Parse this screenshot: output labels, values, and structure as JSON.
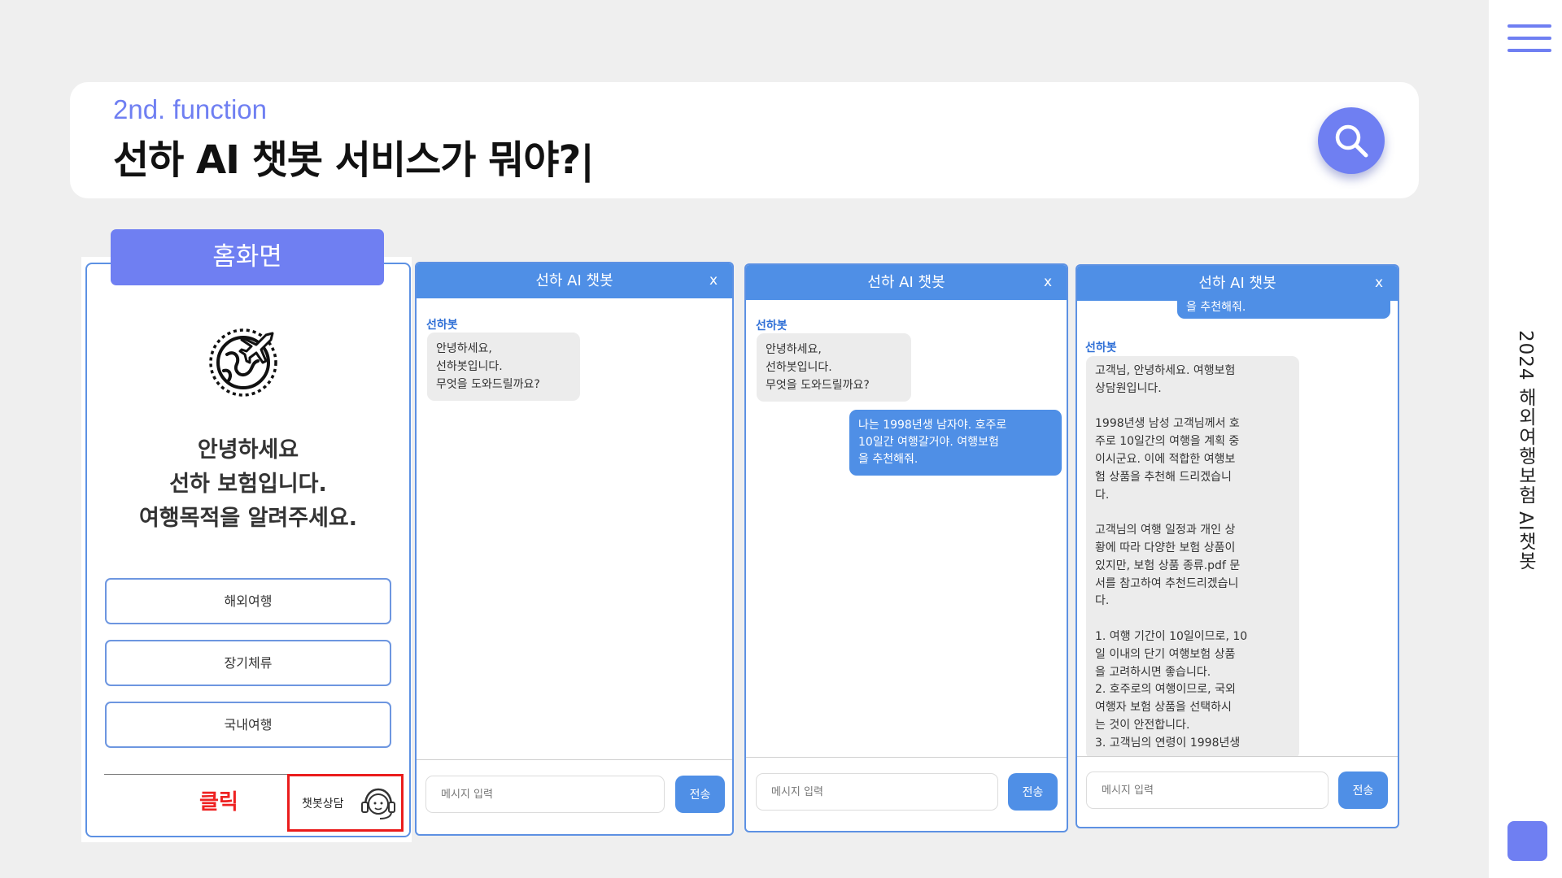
{
  "header": {
    "subtitle": "2nd. function",
    "title": "선하 AI 챗봇 서비스가 뭐야?|"
  },
  "sidebar": {
    "vertical_title": "2024 해외여행보험 AI챗봇",
    "menu_icon": "hamburger-icon"
  },
  "home": {
    "tab_label": "홈화면",
    "greeting_lines": [
      "안녕하세요",
      "선하 보험입니다.",
      "여행목적을 알려주세요."
    ],
    "options": [
      "해외여행",
      "장기체류",
      "국내여행"
    ],
    "click_label": "클릭",
    "chat_button_label": "챗봇상담",
    "icons": [
      "globe-plane-icon",
      "headset-agent-icon"
    ]
  },
  "chat": {
    "title": "선하 AI 챗봇",
    "close_label": "x",
    "bot_name": "선하봇",
    "input_placeholder": "메시지 입력",
    "send_label": "전송",
    "greeting": "안녕하세요,\n선하봇입니다.\n무엇을 도와드릴까요?",
    "user_message": "나는 1998년생 남자야. 호주로\n10일간 여행갈거야. 여행보험\n을 추천해줘.",
    "user_message_tail": "을 추천해줘.",
    "bot_reply": "고객님, 안녕하세요. 여행보험\n상담원입니다.\n\n1998년생 남성 고객님께서 호\n주로 10일간의 여행을 계획 중\n이시군요. 이에 적합한 여행보\n험 상품을 추천해 드리겠습니\n다.\n\n고객님의 여행 일정과 개인 상\n황에 따라 다양한 보험 상품이\n있지만, 보험 상품 종류.pdf 문\n서를 참고하여 추천드리겠습니\n다.\n\n1. 여행 기간이 10일이므로, 10\n일 이내의 단기 여행보험 상품\n을 고려하시면 좋습니다.\n2. 호주로의 여행이므로, 국외\n여행자 보험 상품을 선택하시\n는 것이 안전합니다.\n3. 고객님의 연령이 1998년생"
  },
  "colors": {
    "accent": "#6f7ff2",
    "chat_blue": "#4f8fe6",
    "click_red": "#ee2222"
  }
}
